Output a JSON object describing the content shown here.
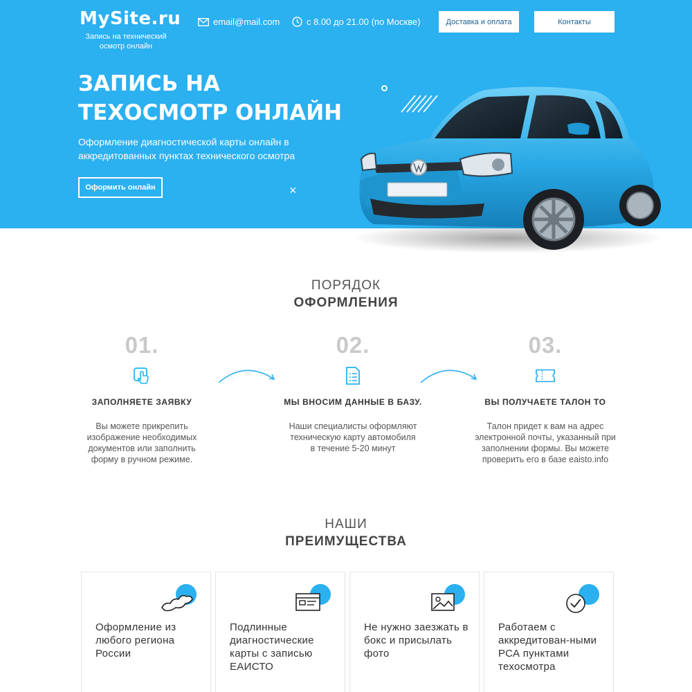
{
  "header": {
    "logo": "MySite.ru",
    "logo_sub": "Запись на технический осмотр онлайн",
    "email": "email@mail.com",
    "hours": "с 8.00 до 21.00 (по Москве)",
    "nav": {
      "delivery": "Доставка и оплата",
      "contacts": "Контакты"
    }
  },
  "hero": {
    "title": "ЗАПИСЬ НА ТЕХОСМОТР ОНЛАЙН",
    "subtitle": "Оформление диагностической карты онлайн в аккредитованных пунктах технического осмотра",
    "cta": "Оформить онлайн"
  },
  "steps_section": {
    "heading_light": "ПОРЯДОК",
    "heading_bold": "ОФОРМЛЕНИЯ",
    "steps": [
      {
        "num": "01.",
        "title": "ЗАПОЛНЯЕТЕ ЗАЯВКУ",
        "text": "Вы можете прикрепить изображение необходимых документов или заполнить форму в ручном режиме.",
        "icon": "touch-form-icon"
      },
      {
        "num": "02.",
        "title": "МЫ ВНОСИМ ДАННЫЕ В БАЗУ.",
        "text": "Наши специалисты оформляют техническую карту автомобиля в течение 5-20 минут",
        "icon": "document-list-icon"
      },
      {
        "num": "03.",
        "title": "ВЫ ПОЛУЧАЕТЕ ТАЛОН ТО",
        "text": "Талон придет к вам на адрес электронной почты, указанный при заполнении формы. Вы можете проверить его в базе eaisto.info",
        "icon": "ticket-icon"
      }
    ]
  },
  "benefits_section": {
    "heading_light": "НАШИ",
    "heading_bold": "ПРЕИМУЩЕСТВА",
    "cards": [
      {
        "text": "Оформление из любого региона России",
        "icon": "russia-map-icon"
      },
      {
        "text": "Подлинные диагностические карты с записью ЕАИСТО",
        "icon": "id-card-icon"
      },
      {
        "text": "Не нужно заезжать в бокс и присылать фото",
        "icon": "photo-icon"
      },
      {
        "text": "Работаем с аккредитован-ными РСА пунктами техосмотра",
        "icon": "check-circle-icon"
      }
    ]
  },
  "colors": {
    "accent": "#2bb0f0",
    "step_number": "#c9c9c9"
  }
}
